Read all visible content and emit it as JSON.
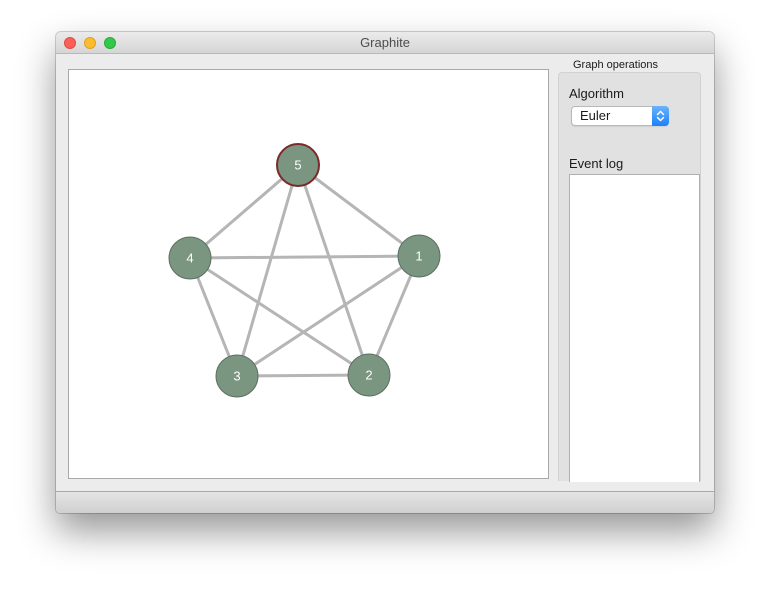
{
  "window": {
    "title": "Graphite"
  },
  "graph": {
    "node_fill": "#7a9580",
    "node_stroke": "#5b6f61",
    "selected_stroke": "#7a2a2a",
    "edge_color": "#b5b5b5",
    "selected_node": "5",
    "nodes": [
      {
        "id": "1",
        "label": "1"
      },
      {
        "id": "2",
        "label": "2"
      },
      {
        "id": "3",
        "label": "3"
      },
      {
        "id": "4",
        "label": "4"
      },
      {
        "id": "5",
        "label": "5"
      }
    ],
    "edges": [
      [
        "5",
        "1"
      ],
      [
        "5",
        "2"
      ],
      [
        "5",
        "3"
      ],
      [
        "5",
        "4"
      ],
      [
        "1",
        "2"
      ],
      [
        "1",
        "3"
      ],
      [
        "1",
        "4"
      ],
      [
        "2",
        "3"
      ],
      [
        "2",
        "4"
      ],
      [
        "3",
        "4"
      ]
    ]
  },
  "panel": {
    "title": "Graph operations",
    "algorithm_label": "Algorithm",
    "algorithm_value": "Euler",
    "event_log_label": "Event log",
    "event_log_entries": []
  },
  "icons": {
    "close": "close-icon",
    "minimize": "minimize-icon",
    "zoom": "zoom-icon",
    "select_arrows": "chevron-up-down-icon"
  }
}
